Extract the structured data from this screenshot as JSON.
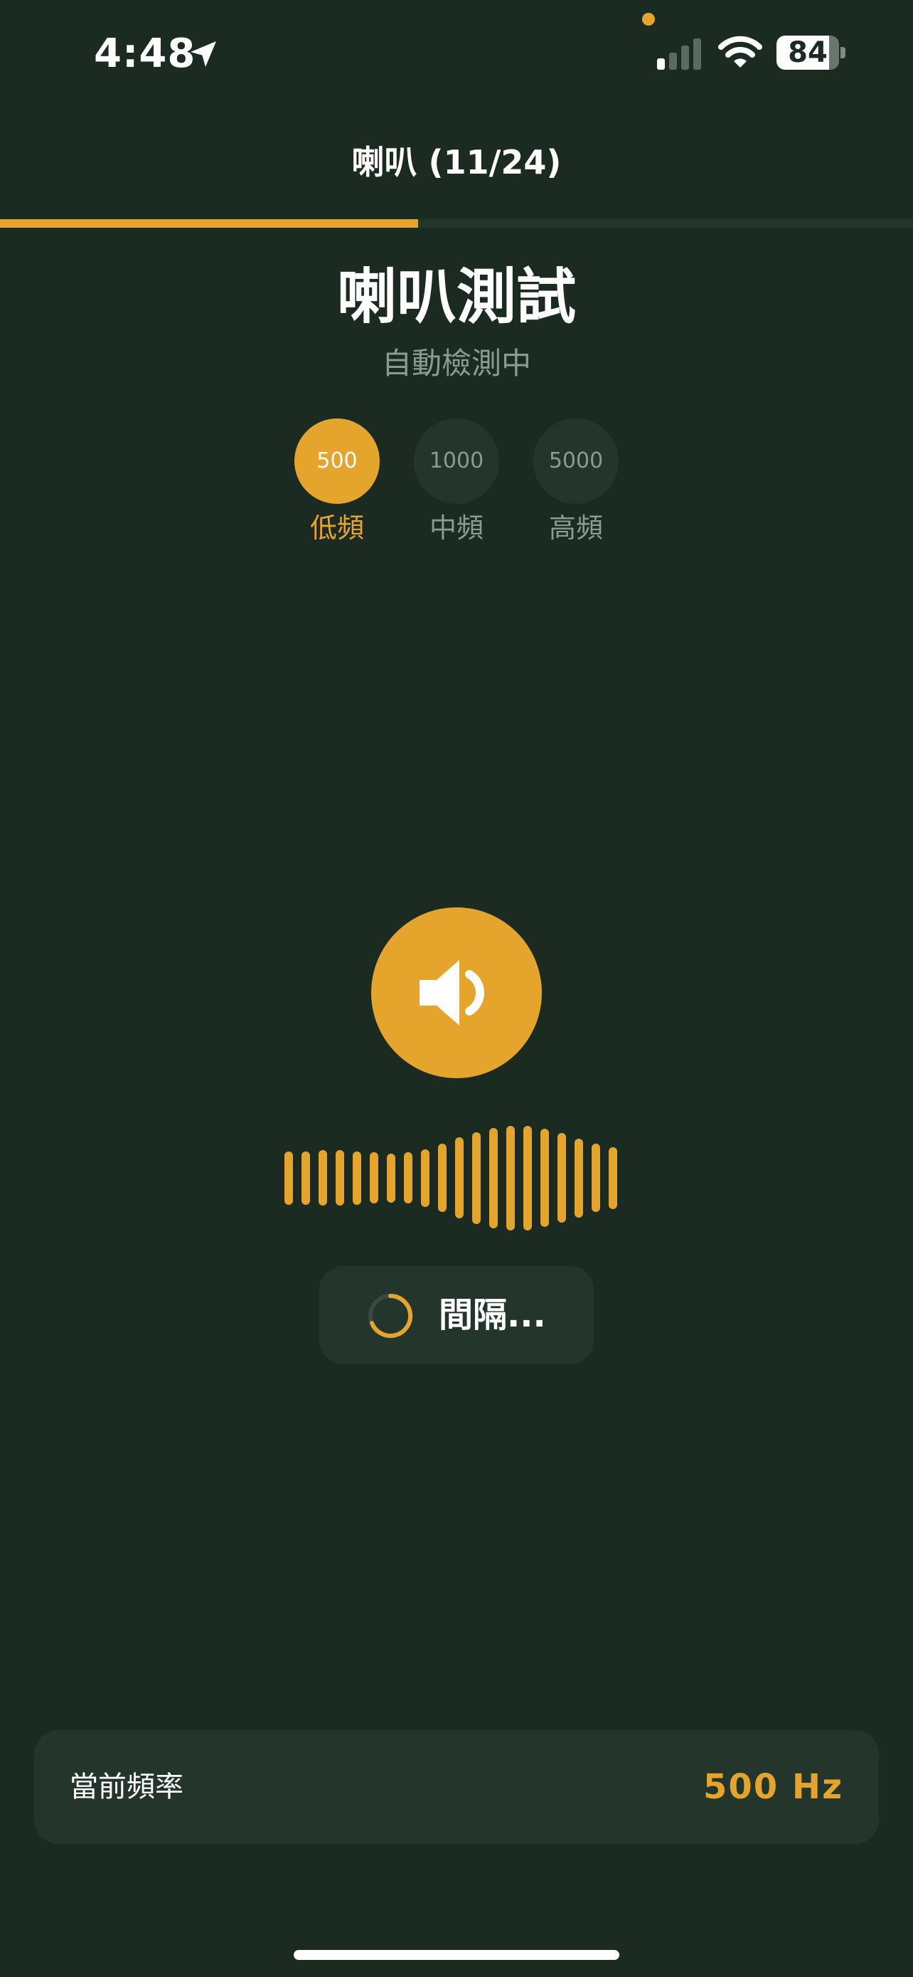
{
  "colors": {
    "background": "#1b2b22",
    "surface": "#24362c",
    "accent": "#e5a52d",
    "muted_text": "#8a9c91",
    "text": "#ffffff"
  },
  "status_bar": {
    "time": "4:48",
    "battery_level": "84",
    "location_icon": "location-arrow-icon",
    "signal_icon": "cellular-signal-icon",
    "wifi_icon": "wifi-icon"
  },
  "header": {
    "title": "喇叭 (11/24)",
    "progress_fraction": 0.4583
  },
  "main": {
    "title": "喇叭測試",
    "subtitle": "自動檢測中",
    "frequencies": [
      {
        "value": "500",
        "label": "低頻",
        "active": true
      },
      {
        "value": "1000",
        "label": "中頻",
        "active": false
      },
      {
        "value": "5000",
        "label": "高頻",
        "active": false
      }
    ],
    "speaker_icon": "speaker-volume-icon",
    "waveform_levels": [
      0.5,
      0.5,
      0.52,
      0.52,
      0.5,
      0.48,
      0.46,
      0.48,
      0.54,
      0.64,
      0.76,
      0.86,
      0.94,
      0.98,
      0.98,
      0.92,
      0.84,
      0.74,
      0.64,
      0.58
    ]
  },
  "status_pill": {
    "text": "間隔...",
    "spinner_icon": "loading-spinner-icon"
  },
  "current_frequency": {
    "label": "當前頻率",
    "value": "500 Hz"
  }
}
